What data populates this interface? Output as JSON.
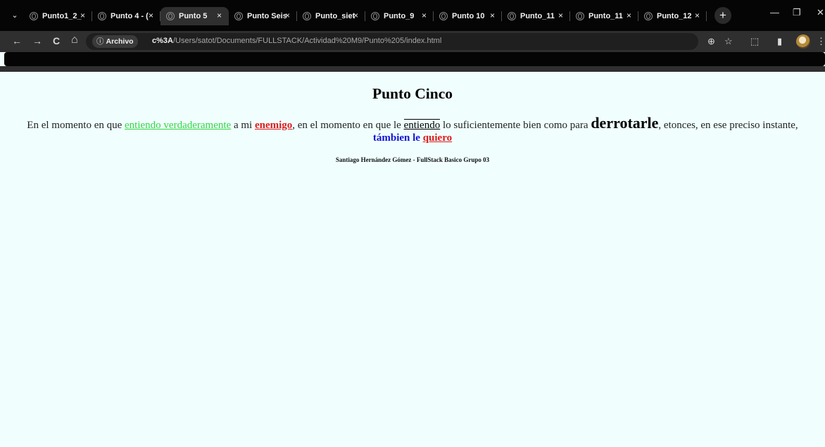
{
  "browser": {
    "tab_search_glyph": "⌄",
    "tabs": [
      {
        "title": "Punto1_2_",
        "active": false
      },
      {
        "title": "Punto 4 - (",
        "active": false
      },
      {
        "title": "Punto 5",
        "active": true
      },
      {
        "title": "Punto Seis",
        "active": false
      },
      {
        "title": "Punto_siet",
        "active": false
      },
      {
        "title": "Punto_9",
        "active": false
      },
      {
        "title": "Punto 10",
        "active": false
      },
      {
        "title": "Punto_11",
        "active": false
      },
      {
        "title": "Punto_11",
        "active": false
      },
      {
        "title": "Punto_12",
        "active": false
      }
    ],
    "close_glyph": "×",
    "new_tab_glyph": "+",
    "window_controls": {
      "minimize": "—",
      "restore": "❐",
      "close": "✕"
    },
    "toolbar": {
      "back_glyph": "←",
      "forward_glyph": "→",
      "reload_glyph": "C",
      "home_glyph": "⌂",
      "security_chip": "Archivo",
      "info_glyph": "ⓘ",
      "url_host": "c%3A",
      "url_path": "/Users/satot/Documents/FULLSTACK/Actividad%20M9/Punto%205/index.html",
      "zoom_glyph": "⊕",
      "bookmark_glyph": "☆",
      "extensions_glyph": "⬚",
      "sidepanel_glyph": "▮",
      "menu_glyph": "⋮"
    }
  },
  "page": {
    "title": "Punto Cinco",
    "paragraph": {
      "t1": "En el momento en que ",
      "green_link": "entiendo verdaderamente",
      "t2": " a mi ",
      "enemy": "enemigo",
      "t3": ", en el momento en que le ",
      "boxed": "entiendo",
      "t4": " lo suficientemente bien como para ",
      "big": "derrotarle",
      "t5": ", etonces, en ese preciso instante,",
      "blue": "támbien le",
      "space": " ",
      "red_end": "quiero"
    },
    "credit": "Santiago Hernández Gómez - FullStack Basico Grupo 03"
  },
  "colors": {
    "page_bg": "#f0fffe",
    "green": "#33d645",
    "red": "#e01b1b",
    "blue": "#1313d6",
    "chrome_dark": "#050505",
    "chrome_toolbar": "#2f2f2f"
  }
}
